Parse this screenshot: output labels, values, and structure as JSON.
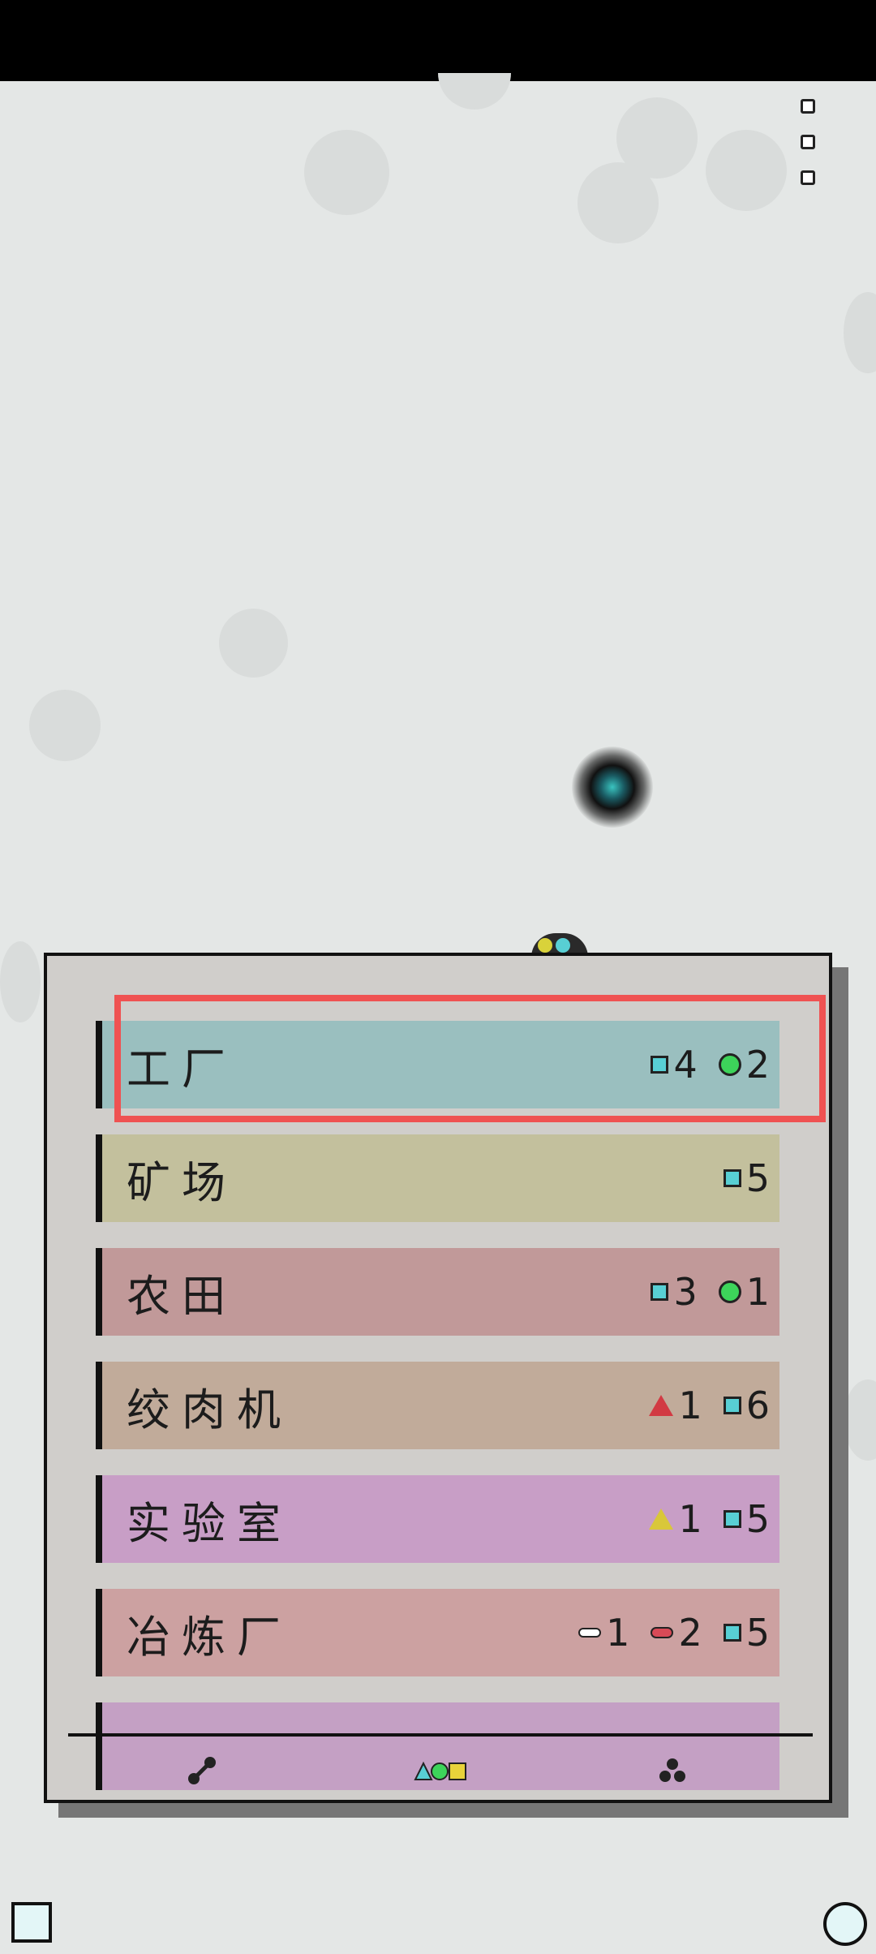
{
  "colors": {
    "factory": "#9abfbf",
    "mine": "#c3c09d",
    "farm": "#c19999",
    "meat_grinder": "#c1ab9a",
    "lab": "#c89ec6",
    "smelter": "#cca1a1",
    "next_item": "#c4a0c4",
    "highlight": "#ef5252"
  },
  "buildings": [
    {
      "name": "工厂",
      "costs": [
        {
          "icon": "square-icon",
          "qty": "4"
        },
        {
          "icon": "circle-icon",
          "qty": "2"
        }
      ]
    },
    {
      "name": "矿场",
      "costs": [
        {
          "icon": "square-icon",
          "qty": "5"
        }
      ]
    },
    {
      "name": "农田",
      "costs": [
        {
          "icon": "square-icon",
          "qty": "3"
        },
        {
          "icon": "circle-icon",
          "qty": "1"
        }
      ]
    },
    {
      "name": "绞肉机",
      "costs": [
        {
          "icon": "red-triangle-icon",
          "qty": "1"
        },
        {
          "icon": "square-icon",
          "qty": "6"
        }
      ]
    },
    {
      "name": "实验室",
      "costs": [
        {
          "icon": "yellow-triangle-icon",
          "qty": "1"
        },
        {
          "icon": "square-icon",
          "qty": "5"
        }
      ]
    },
    {
      "name": "冶炼厂",
      "costs": [
        {
          "icon": "bone-icon",
          "qty": "1"
        },
        {
          "icon": "sausage-icon",
          "qty": "2"
        },
        {
          "icon": "square-icon",
          "qty": "5"
        }
      ]
    }
  ],
  "tabs": [
    {
      "icon": "connect-icon"
    },
    {
      "icon": "shapes-icon"
    },
    {
      "icon": "group-icon"
    }
  ]
}
